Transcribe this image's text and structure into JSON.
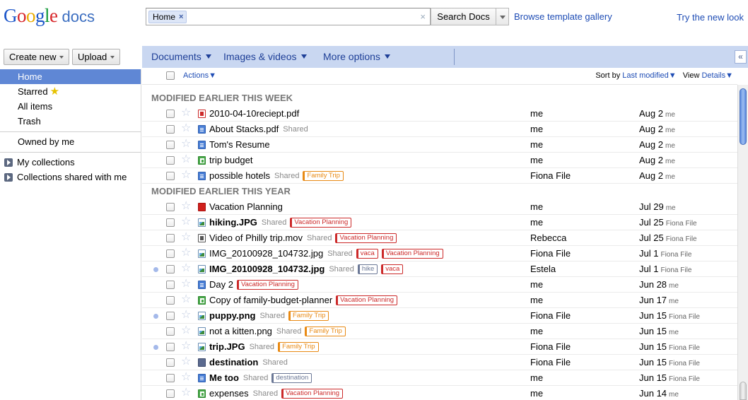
{
  "logo": {
    "google_letters": [
      "G",
      "o",
      "o",
      "g",
      "l",
      "e"
    ],
    "product": "docs"
  },
  "search": {
    "chip_label": "Home",
    "chip_remove": "×",
    "clear": "×",
    "button_label": "Search Docs"
  },
  "header_links": {
    "browse": "Browse template gallery",
    "new_look": "Try the new look"
  },
  "left_toolbar": {
    "create_new": "Create new",
    "upload": "Upload"
  },
  "menubar": {
    "documents": "Documents",
    "images_videos": "Images & videos",
    "more_options": "More options",
    "collapse": "«"
  },
  "sidebar": {
    "home": "Home",
    "starred": "Starred",
    "all_items": "All items",
    "trash": "Trash",
    "owned_by_me": "Owned by me",
    "my_collections": "My collections",
    "shared_collections": "Collections shared with me"
  },
  "actions_bar": {
    "actions": "Actions",
    "sort_by": "Sort by",
    "sort_value": "Last modified",
    "view": "View",
    "view_value": "Details"
  },
  "colors": {
    "accent": "#5f87d5",
    "menubar": "#c9d7f1",
    "link": "#1f4db5",
    "tag_family_trip": "#e88a14",
    "tag_vacation": "#cc2a2a",
    "tag_gray": "#6b7896"
  },
  "sections": [
    {
      "title": "MODIFIED EARLIER THIS WEEK",
      "rows": [
        {
          "name": "2010-04-10reciept.pdf",
          "icon": "pdf-icon",
          "bold": false,
          "dot": false,
          "shared": "",
          "tags": [],
          "owner": "me",
          "date": "Aug 2",
          "by": "me"
        },
        {
          "name": "About Stacks.pdf",
          "icon": "doc-icon",
          "bold": false,
          "dot": false,
          "shared": "Shared",
          "tags": [],
          "owner": "me",
          "date": "Aug 2",
          "by": "me"
        },
        {
          "name": "Tom's Resume",
          "icon": "doc-icon",
          "bold": false,
          "dot": false,
          "shared": "",
          "tags": [],
          "owner": "me",
          "date": "Aug 2",
          "by": "me"
        },
        {
          "name": "trip budget",
          "icon": "spreadsheet-icon",
          "bold": false,
          "dot": false,
          "shared": "",
          "tags": [],
          "owner": "me",
          "date": "Aug 2",
          "by": "me"
        },
        {
          "name": "possible hotels",
          "icon": "doc-icon",
          "bold": false,
          "dot": false,
          "shared": "Shared",
          "tags": [
            {
              "label": "Family Trip",
              "color": "#e88a14"
            }
          ],
          "owner": "Fiona File",
          "date": "Aug 2",
          "by": "me"
        }
      ]
    },
    {
      "title": "MODIFIED EARLIER THIS YEAR",
      "rows": [
        {
          "name": "Vacation Planning",
          "icon": "collection-icon",
          "bold": false,
          "dot": false,
          "shared": "",
          "tags": [],
          "owner": "me",
          "date": "Jul 29",
          "by": "me"
        },
        {
          "name": "hiking.JPG",
          "icon": "image-icon",
          "bold": true,
          "dot": false,
          "shared": "Shared",
          "tags": [
            {
              "label": "Vacation Planning",
              "color": "#cc2a2a"
            }
          ],
          "owner": "me",
          "date": "Jul 25",
          "by": "Fiona File"
        },
        {
          "name": "Video of Philly trip.mov",
          "icon": "video-icon",
          "bold": false,
          "dot": false,
          "shared": "Shared",
          "tags": [
            {
              "label": "Vacation Planning",
              "color": "#cc2a2a"
            }
          ],
          "owner": "Rebecca",
          "date": "Jul 25",
          "by": "Fiona File"
        },
        {
          "name": "IMG_20100928_104732.jpg",
          "icon": "image-icon",
          "bold": false,
          "dot": false,
          "shared": "Shared",
          "tags": [
            {
              "label": "vaca",
              "color": "#cc2a2a"
            },
            {
              "label": "Vacation Planning",
              "color": "#cc2a2a"
            }
          ],
          "owner": "Fiona File",
          "date": "Jul 1",
          "by": "Fiona File"
        },
        {
          "name": "IMG_20100928_104732.jpg",
          "icon": "image-icon",
          "bold": true,
          "dot": true,
          "shared": "Shared",
          "tags": [
            {
              "label": "hike",
              "color": "#6b7896"
            },
            {
              "label": "vaca",
              "color": "#cc2a2a"
            }
          ],
          "owner": "Estela",
          "date": "Jul 1",
          "by": "Fiona File"
        },
        {
          "name": "Day 2",
          "icon": "doc-icon",
          "bold": false,
          "dot": false,
          "shared": "",
          "tags": [
            {
              "label": "Vacation Planning",
              "color": "#cc2a2a"
            }
          ],
          "owner": "me",
          "date": "Jun 28",
          "by": "me"
        },
        {
          "name": "Copy of family-budget-planner",
          "icon": "spreadsheet-icon",
          "bold": false,
          "dot": false,
          "shared": "",
          "tags": [
            {
              "label": "Vacation Planning",
              "color": "#cc2a2a"
            }
          ],
          "owner": "me",
          "date": "Jun 17",
          "by": "me"
        },
        {
          "name": "puppy.png",
          "icon": "image-icon",
          "bold": true,
          "dot": true,
          "shared": "Shared",
          "tags": [
            {
              "label": "Family Trip",
              "color": "#e88a14"
            }
          ],
          "owner": "Fiona File",
          "date": "Jun 15",
          "by": "Fiona File"
        },
        {
          "name": "not a kitten.png",
          "icon": "image-icon",
          "bold": false,
          "dot": false,
          "shared": "Shared",
          "tags": [
            {
              "label": "Family Trip",
              "color": "#e88a14"
            }
          ],
          "owner": "me",
          "date": "Jun 15",
          "by": "me"
        },
        {
          "name": "trip.JPG",
          "icon": "image-icon",
          "bold": true,
          "dot": true,
          "shared": "Shared",
          "tags": [
            {
              "label": "Family Trip",
              "color": "#e88a14"
            }
          ],
          "owner": "Fiona File",
          "date": "Jun 15",
          "by": "Fiona File"
        },
        {
          "name": "destination",
          "icon": "gray-collection-icon",
          "bold": true,
          "dot": false,
          "shared": "Shared",
          "tags": [],
          "owner": "Fiona File",
          "date": "Jun 15",
          "by": "Fiona File"
        },
        {
          "name": "Me too",
          "icon": "doc-icon",
          "bold": true,
          "dot": false,
          "shared": "Shared",
          "tags": [
            {
              "label": "destination",
              "color": "#6b7896"
            }
          ],
          "owner": "me",
          "date": "Jun 15",
          "by": "Fiona File"
        },
        {
          "name": "expenses",
          "icon": "spreadsheet-icon",
          "bold": false,
          "dot": false,
          "shared": "Shared",
          "tags": [
            {
              "label": "Vacation Planning",
              "color": "#cc2a2a"
            }
          ],
          "owner": "me",
          "date": "Jun 14",
          "by": "me"
        }
      ]
    }
  ]
}
